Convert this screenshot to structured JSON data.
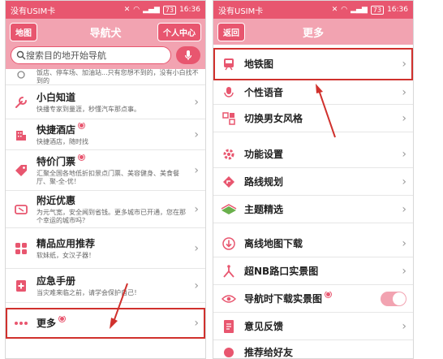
{
  "colors": {
    "accent": "#e8566f",
    "accent_light": "#f2a3b1",
    "annotation_red": "#d0312d"
  },
  "left": {
    "status": {
      "carrier": "没有USIM卡",
      "battery": "73",
      "time": "16:36"
    },
    "header": {
      "left_button": "地图",
      "title": "导航犬",
      "right_button": "个人中心"
    },
    "search": {
      "placeholder": "搜索目的地开始导航"
    },
    "items": [
      {
        "name": "",
        "desc": "饭店、停车场、加油站...只有您想不到的，没有小白找不到的",
        "icon": "partial-icon"
      },
      {
        "name": "小白知道",
        "desc": "快播专家到量涯，秒懂汽车那点事。",
        "icon": "wrench-icon"
      },
      {
        "name": "快捷酒店",
        "desc": "快捷酒店，随时找",
        "icon": "hotel-icon"
      },
      {
        "name": "特价门票",
        "desc": "汇聚全国各地低折扣景点门票、美容健身、美食餐厅、聚-全-优！",
        "icon": "tag-icon"
      },
      {
        "name": "附近优惠",
        "desc": "为元气宽，安全闻到省钱。更多城市已开通，您在那个幸运的城市吗？",
        "icon": "coupon-icon"
      },
      {
        "name": "精品应用推荐",
        "desc": "软妹纸，女汉子器！",
        "icon": "apps-icon"
      },
      {
        "name": "应急手册",
        "desc": "当灾难来临之前，请学会保护自己！",
        "icon": "manual-icon"
      },
      {
        "name": "更多",
        "desc": "",
        "icon": "more-dots-icon"
      }
    ]
  },
  "right": {
    "status": {
      "carrier": "没有USIM卡",
      "battery": "73",
      "time": "16:36"
    },
    "header": {
      "back_button": "返回",
      "title": "更多"
    },
    "items": [
      {
        "name": "地铁图",
        "icon": "subway-icon"
      },
      {
        "name": "个性语音",
        "icon": "voice-icon"
      },
      {
        "name": "切换男女风格",
        "icon": "gender-icon"
      },
      {
        "name": "功能设置",
        "icon": "gear-icon"
      },
      {
        "name": "路线规划",
        "icon": "route-icon"
      },
      {
        "name": "主题精选",
        "icon": "theme-icon"
      },
      {
        "name": "离线地图下载",
        "icon": "download-icon"
      },
      {
        "name": "超NB路口实景图",
        "icon": "junction-icon"
      },
      {
        "name": "导航时下载实景图",
        "icon": "eye-icon"
      },
      {
        "name": "意见反馈",
        "icon": "feedback-icon"
      },
      {
        "name": "推荐给好友",
        "icon": "share-icon"
      }
    ]
  }
}
